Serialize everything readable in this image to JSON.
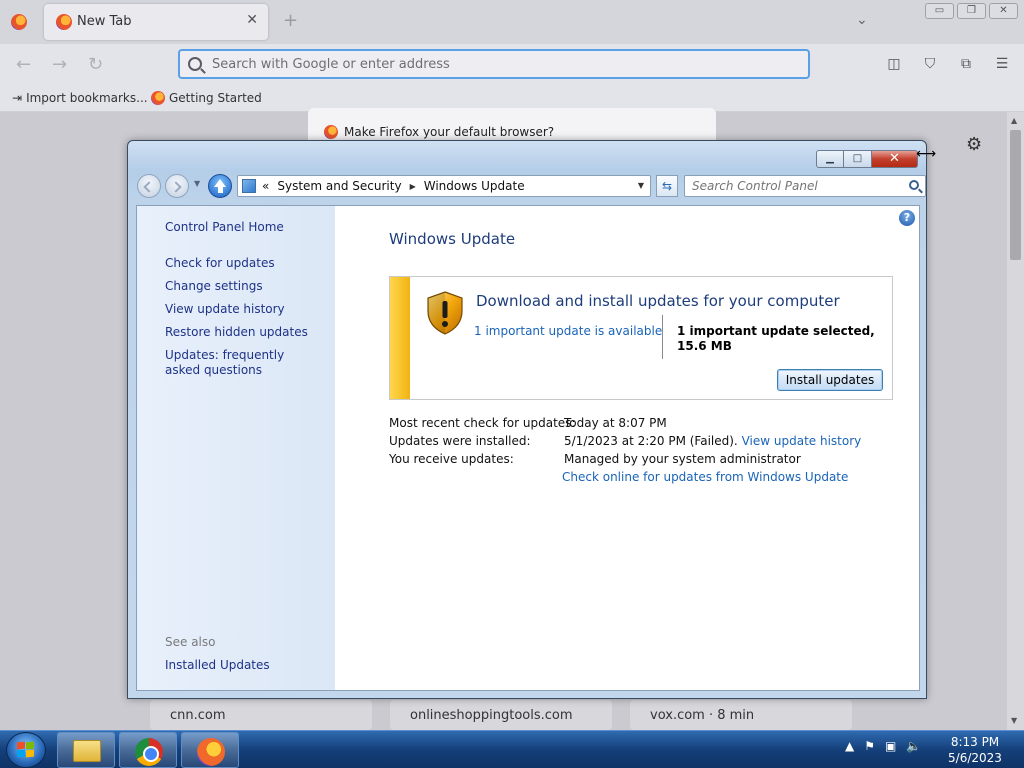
{
  "firefox": {
    "tab_title": "New Tab",
    "tab_close": "✕",
    "new_tab": "+",
    "tab_list": "⌄",
    "window_buttons": [
      "▭",
      "❐",
      "✕"
    ],
    "address_placeholder": "Search with Google or enter address",
    "bookmarks": [
      "Import bookmarks...",
      "Getting Started"
    ],
    "notification": "Make Firefox your default browser?",
    "top_sites": [
      "cnn.com",
      "onlineshoppingtools.com",
      "vox.com · 8 min"
    ],
    "toolbar_icons": [
      "pocket-icon",
      "shield-icon",
      "extensions-icon",
      "menu-icon"
    ]
  },
  "control_panel": {
    "breadcrumb_prefix": "«",
    "breadcrumbs": [
      "System and Security",
      "Windows Update"
    ],
    "search_placeholder": "Search Control Panel",
    "help": "?",
    "caption": {
      "min": "▁",
      "max": "□",
      "close": "✕"
    },
    "sidebar": {
      "home": "Control Panel Home",
      "items": [
        "Check for updates",
        "Change settings",
        "View update history",
        "Restore hidden updates",
        "Updates: frequently asked questions"
      ],
      "see_also_label": "See also",
      "see_also_items": [
        "Installed Updates"
      ]
    },
    "page_title": "Windows Update",
    "update_box": {
      "heading": "Download and install updates for your computer",
      "available_link": "1 important update is available",
      "selected_text": "1 important update selected, 15.6 MB",
      "install_button": "Install updates"
    },
    "status": {
      "recent_check_label": "Most recent check for updates:",
      "recent_check_value": "Today at 8:07 PM",
      "installed_label": "Updates were installed:",
      "installed_value": "5/1/2023 at 2:20 PM (Failed).",
      "installed_link": "View update history",
      "receive_label": "You receive updates:",
      "receive_value": "Managed by your system administrator",
      "online_link": "Check online for updates from Windows Update"
    }
  },
  "taskbar": {
    "time": "8:13 PM",
    "date": "5/6/2023",
    "pinned": [
      "explorer",
      "chrome",
      "firefox"
    ]
  }
}
